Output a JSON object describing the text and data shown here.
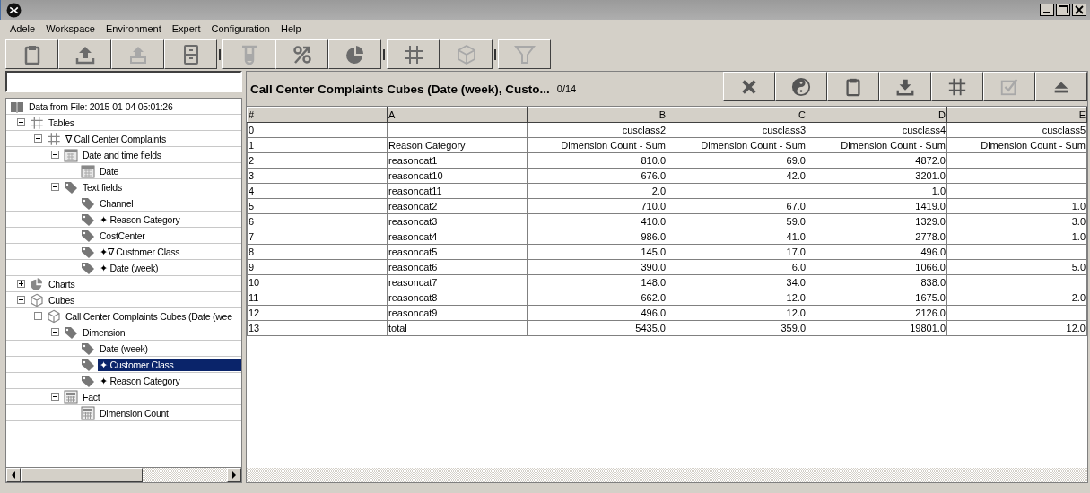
{
  "menu": [
    "Adele",
    "Workspace",
    "Environment",
    "Expert",
    "Configuration",
    "Help"
  ],
  "toolbar": [
    {
      "kind": "clipboard",
      "disabled": false,
      "group_end": false
    },
    {
      "kind": "upload",
      "disabled": false,
      "group_end": false
    },
    {
      "kind": "upload-tray",
      "disabled": true,
      "group_end": false
    },
    {
      "kind": "cabinet",
      "disabled": false,
      "group_end": true
    },
    {
      "kind": "tube",
      "disabled": true,
      "group_end": false
    },
    {
      "kind": "percent",
      "disabled": false,
      "group_end": false
    },
    {
      "kind": "pie",
      "disabled": false,
      "group_end": true
    },
    {
      "kind": "grid",
      "disabled": false,
      "group_end": false
    },
    {
      "kind": "cube",
      "disabled": true,
      "group_end": true
    },
    {
      "kind": "funnel",
      "disabled": true,
      "group_end": false
    }
  ],
  "tree": [
    {
      "label": "Data from File: 2015-01-04 05:01:26",
      "kind": "book",
      "selected": false,
      "children": [
        {
          "label": "Tables",
          "kind": "grid",
          "expanded": true,
          "selected": false,
          "children": [
            {
              "label": "∇ Call Center Complaints",
              "kind": "grid",
              "expanded": true,
              "selected": false,
              "children": [
                {
                  "label": "Date and time fields",
                  "kind": "calendar",
                  "expanded": true,
                  "selected": false,
                  "children": [
                    {
                      "label": "Date",
                      "kind": "calendar",
                      "selected": false
                    }
                  ]
                },
                {
                  "label": "Text fields",
                  "kind": "tag",
                  "expanded": true,
                  "selected": false,
                  "children": [
                    {
                      "label": "Channel",
                      "kind": "tag",
                      "selected": false
                    },
                    {
                      "label": "✦ Reason Category",
                      "kind": "tag",
                      "selected": false
                    },
                    {
                      "label": "CostCenter",
                      "kind": "tag",
                      "selected": false
                    },
                    {
                      "label": "✦∇ Customer Class",
                      "kind": "tag",
                      "selected": false
                    },
                    {
                      "label": "✦ Date (week)",
                      "kind": "tag",
                      "selected": false
                    }
                  ]
                }
              ]
            }
          ]
        },
        {
          "label": "Charts",
          "kind": "pie",
          "expanded": false,
          "selected": false
        },
        {
          "label": "Cubes",
          "kind": "cube",
          "expanded": true,
          "selected": false,
          "children": [
            {
              "label": "Call Center Complaints Cubes (Date (wee",
              "kind": "cube",
              "expanded": true,
              "selected": false,
              "children": [
                {
                  "label": "Dimension",
                  "kind": "tag",
                  "expanded": true,
                  "selected": false,
                  "children": [
                    {
                      "label": "Date (week)",
                      "kind": "tag",
                      "selected": false
                    },
                    {
                      "label": "✦ Customer Class",
                      "kind": "tag",
                      "selected": true
                    },
                    {
                      "label": "✦ Reason Category",
                      "kind": "tag",
                      "selected": false
                    }
                  ]
                },
                {
                  "label": "Fact",
                  "kind": "calc",
                  "expanded": true,
                  "selected": false,
                  "children": [
                    {
                      "label": "Dimension Count",
                      "kind": "calc",
                      "selected": false
                    }
                  ]
                }
              ]
            }
          ]
        }
      ]
    }
  ],
  "panel": {
    "title": "Call Center Complaints Cubes (Date (week), Custo...",
    "count": "0/14",
    "actions": [
      {
        "kind": "close",
        "disabled": false
      },
      {
        "kind": "yinyang",
        "disabled": false
      },
      {
        "kind": "clipboard",
        "disabled": false
      },
      {
        "kind": "download",
        "disabled": false
      },
      {
        "kind": "grid",
        "disabled": false
      },
      {
        "kind": "check",
        "disabled": true
      },
      {
        "kind": "eject",
        "disabled": false
      }
    ]
  },
  "table": {
    "columns": [
      "#",
      "A",
      "B",
      "C",
      "D",
      "E"
    ],
    "rows": [
      [
        "0",
        "",
        "cusclass2",
        "cusclass3",
        "cusclass4",
        "cusclass5"
      ],
      [
        "1",
        "Reason Category",
        "Dimension Count - Sum",
        "Dimension Count - Sum",
        "Dimension Count - Sum",
        "Dimension Count - Sum"
      ],
      [
        "2",
        "reasoncat1",
        "810.0",
        "69.0",
        "4872.0",
        ""
      ],
      [
        "3",
        "reasoncat10",
        "676.0",
        "42.0",
        "3201.0",
        ""
      ],
      [
        "4",
        "reasoncat11",
        "2.0",
        "",
        "1.0",
        ""
      ],
      [
        "5",
        "reasoncat2",
        "710.0",
        "67.0",
        "1419.0",
        "1.0"
      ],
      [
        "6",
        "reasoncat3",
        "410.0",
        "59.0",
        "1329.0",
        "3.0"
      ],
      [
        "7",
        "reasoncat4",
        "986.0",
        "41.0",
        "2778.0",
        "1.0"
      ],
      [
        "8",
        "reasoncat5",
        "145.0",
        "17.0",
        "496.0",
        ""
      ],
      [
        "9",
        "reasoncat6",
        "390.0",
        "6.0",
        "1066.0",
        "5.0"
      ],
      [
        "10",
        "reasoncat7",
        "148.0",
        "34.0",
        "838.0",
        ""
      ],
      [
        "11",
        "reasoncat8",
        "662.0",
        "12.0",
        "1675.0",
        "2.0"
      ],
      [
        "12",
        "reasoncat9",
        "496.0",
        "12.0",
        "2126.0",
        ""
      ],
      [
        "13",
        "total",
        "5435.0",
        "359.0",
        "19801.0",
        "12.0"
      ]
    ]
  }
}
